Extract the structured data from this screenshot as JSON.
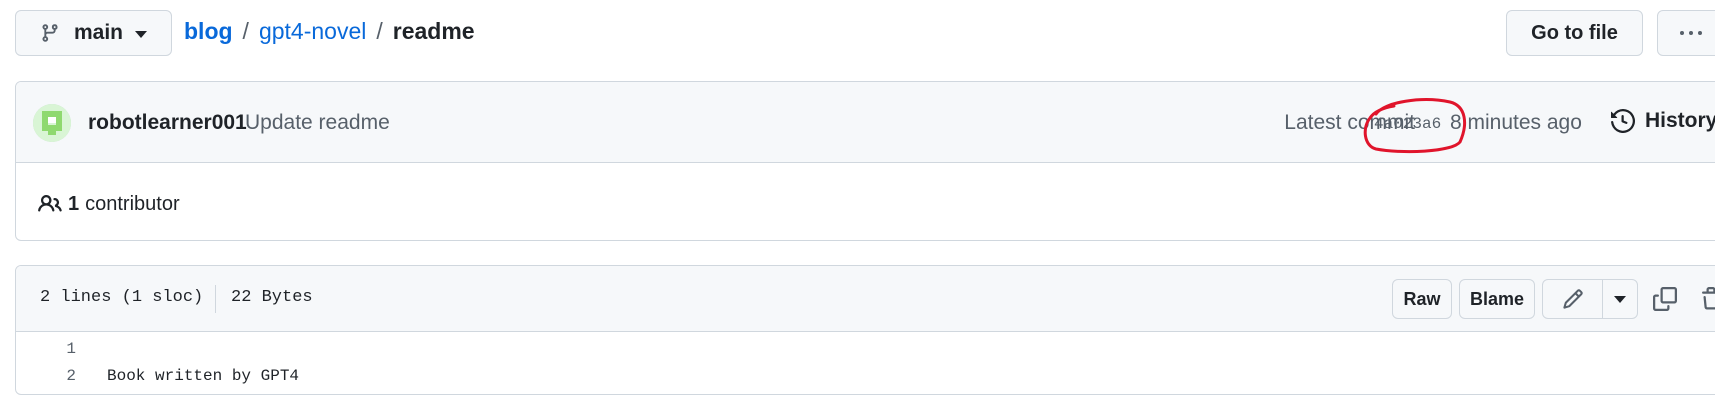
{
  "branch": {
    "name": "main",
    "icon": "git-branch-icon"
  },
  "breadcrumb": {
    "root": "blog",
    "repo": "gpt4-novel",
    "file": "readme",
    "separator": "/"
  },
  "actions": {
    "go_to_file": "Go to file",
    "more_icon": "kebab-horizontal-icon"
  },
  "commit": {
    "author": "robotlearner001",
    "message": "Update readme",
    "latest_label": "Latest commit",
    "sha": "4a023a6",
    "time": "8 minutes ago",
    "history_label": "History",
    "annotation_color": "#e0142b"
  },
  "contributors": {
    "count": "1",
    "label": "contributor",
    "icon": "people-icon"
  },
  "file": {
    "lines_info": "2 lines (1 sloc)",
    "size": "22 Bytes",
    "raw_label": "Raw",
    "blame_label": "Blame",
    "edit_icon": "pencil-icon",
    "copy_icon": "copy-icon",
    "delete_icon": "trash-icon",
    "lines": [
      {
        "number": "1",
        "text": ""
      },
      {
        "number": "2",
        "text": "Book written by GPT4"
      }
    ]
  },
  "colors": {
    "link": "#0969da",
    "border": "#d0d7de",
    "muted": "#57606a",
    "header_bg": "#f6f8fa"
  }
}
